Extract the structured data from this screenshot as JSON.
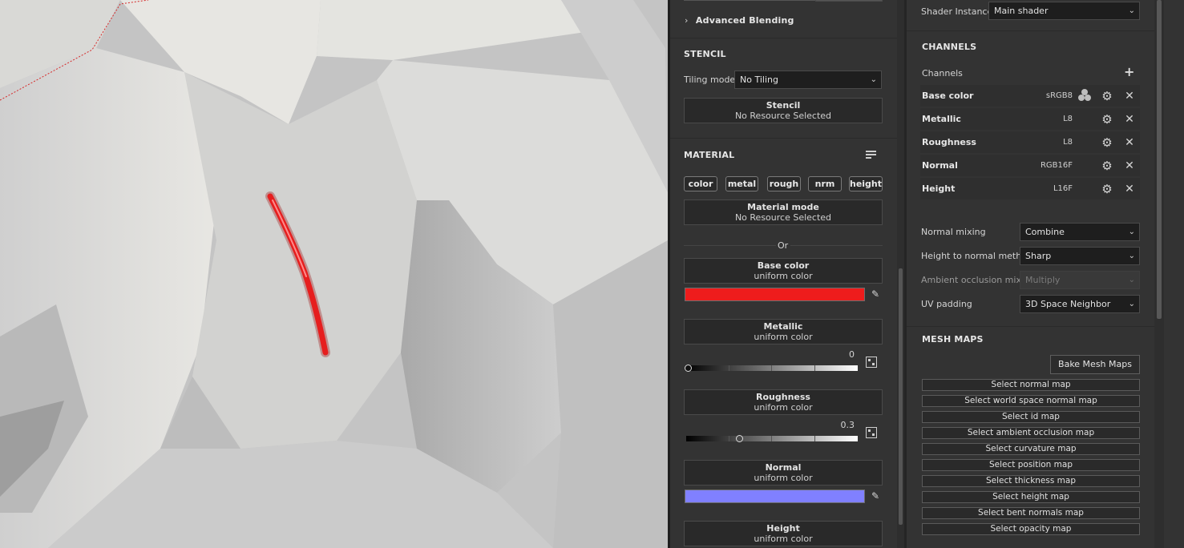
{
  "mid": {
    "advanced_blending": "Advanced Blending",
    "stencil_section": "STENCIL",
    "tiling_mode_label": "Tiling mode",
    "tiling_mode_value": "No Tiling",
    "stencil_title": "Stencil",
    "stencil_sub": "No Resource Selected",
    "material_section": "MATERIAL",
    "chips": [
      "color",
      "metal",
      "rough",
      "nrm",
      "height"
    ],
    "material_mode_title": "Material mode",
    "material_mode_sub": "No Resource Selected",
    "or_label": "Or",
    "base_color_title": "Base color",
    "base_color_sub": "uniform color",
    "base_color_value": "#ee1c1c",
    "metallic_title": "Metallic",
    "metallic_sub": "uniform color",
    "metallic_value": "0",
    "metallic_level": 0.0,
    "roughness_title": "Roughness",
    "roughness_sub": "uniform color",
    "roughness_value": "0.3",
    "roughness_level": 0.3,
    "normal_title": "Normal",
    "normal_sub": "uniform color",
    "normal_color_value": "#8080ff",
    "height_title": "Height",
    "height_sub": "uniform color"
  },
  "right": {
    "shader_instance_label": "Shader Instance",
    "shader_instance_value": "Main shader",
    "channels_section": "CHANNELS",
    "channels_label": "Channels",
    "channels": [
      {
        "name": "Base color",
        "format": "sRGB8"
      },
      {
        "name": "Metallic",
        "format": "L8"
      },
      {
        "name": "Roughness",
        "format": "L8"
      },
      {
        "name": "Normal",
        "format": "RGB16F"
      },
      {
        "name": "Height",
        "format": "L16F"
      }
    ],
    "normal_mixing_label": "Normal mixing",
    "normal_mixing_value": "Combine",
    "height_to_normal_label": "Height to normal method",
    "height_to_normal_value": "Sharp",
    "ao_mixing_label": "Ambient occlusion mixing",
    "ao_mixing_value": "Multiply",
    "uv_padding_label": "UV padding",
    "uv_padding_value": "3D Space Neighbor",
    "mesh_maps_section": "MESH MAPS",
    "bake_button": "Bake Mesh Maps",
    "mesh_maps": [
      "Select normal map",
      "Select world space normal map",
      "Select id map",
      "Select ambient occlusion map",
      "Select curvature map",
      "Select position map",
      "Select thickness map",
      "Select height map",
      "Select bent normals map",
      "Select opacity map"
    ]
  }
}
